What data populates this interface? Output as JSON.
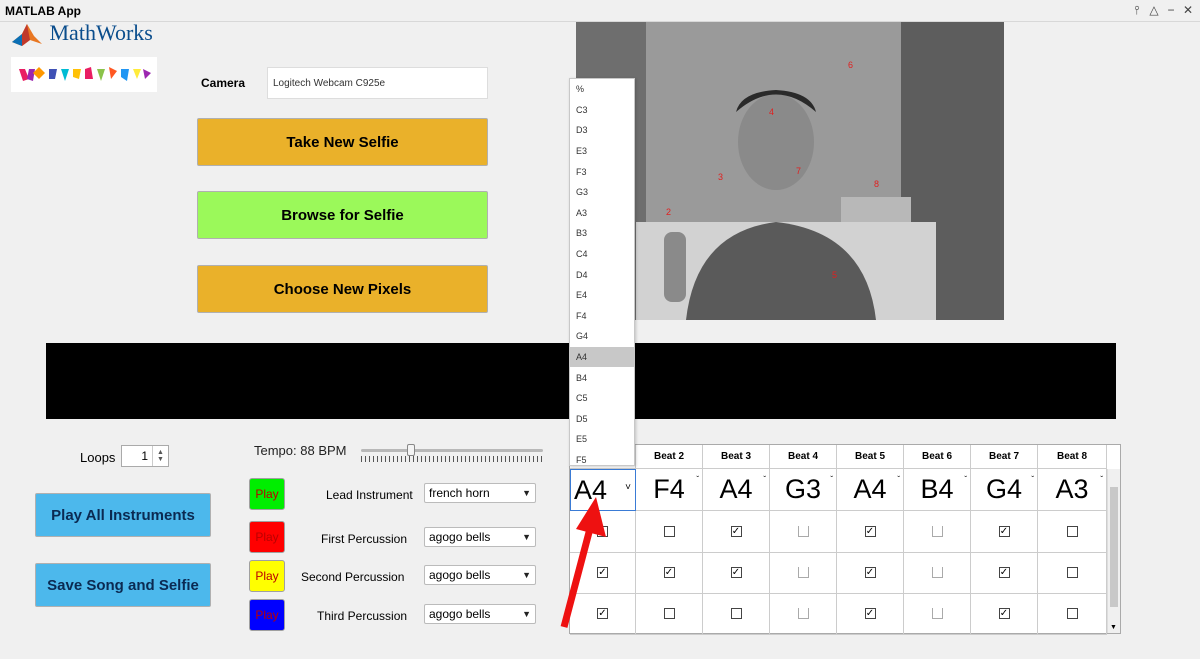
{
  "window": {
    "title": "MATLAB App"
  },
  "logo": {
    "brand": "MathWorks"
  },
  "camera": {
    "label": "Camera",
    "value": "Logitech Webcam C925e"
  },
  "buttons": {
    "take_selfie": "Take New Selfie",
    "browse_selfie": "Browse for Selfie",
    "choose_pixels": "Choose New Pixels",
    "play_all": "Play All Instruments",
    "save_song": "Save Song and Selfie"
  },
  "loops": {
    "label": "Loops",
    "value": "1"
  },
  "tempo": {
    "label": "Tempo: 88 BPM",
    "value_bpm": 88
  },
  "instruments": [
    {
      "play": "Play",
      "color": "#00ee00",
      "label": "Lead Instrument",
      "value": "french horn"
    },
    {
      "play": "Play",
      "color": "#ff0000",
      "label": "First Percussion",
      "value": "agogo bells"
    },
    {
      "play": "Play",
      "color": "#ffff00",
      "label": "Second Percussion",
      "value": "agogo bells"
    },
    {
      "play": "Play",
      "color": "#0000ff",
      "label": "Third Percussion",
      "value": "agogo bells"
    }
  ],
  "photo_markers": [
    "6",
    "4",
    "3",
    "7",
    "8",
    "2",
    "5"
  ],
  "beats": {
    "headers": [
      "",
      "Beat 2",
      "Beat 3",
      "Beat 4",
      "Beat 5",
      "Beat 6",
      "Beat 7",
      "Beat 8"
    ],
    "notes": [
      "A4",
      "F4",
      "A4",
      "G3",
      "A4",
      "B4",
      "G4",
      "A3"
    ],
    "rows": [
      [
        false,
        false,
        true,
        false,
        true,
        false,
        true,
        false
      ],
      [
        true,
        true,
        true,
        false,
        true,
        false,
        true,
        false
      ],
      [
        true,
        false,
        false,
        false,
        true,
        false,
        true,
        false
      ]
    ]
  },
  "note_menu": {
    "options": [
      "%",
      "C3",
      "D3",
      "E3",
      "F3",
      "G3",
      "A3",
      "B3",
      "C4",
      "D4",
      "E4",
      "F4",
      "G4",
      "A4",
      "B4",
      "C5",
      "D5",
      "E5",
      "F5"
    ],
    "selected": "A4"
  },
  "colors": {
    "orange": "#eab12a",
    "green": "#9bf95a",
    "blue": "#4cb8ec",
    "arrow": "#ee1111"
  }
}
